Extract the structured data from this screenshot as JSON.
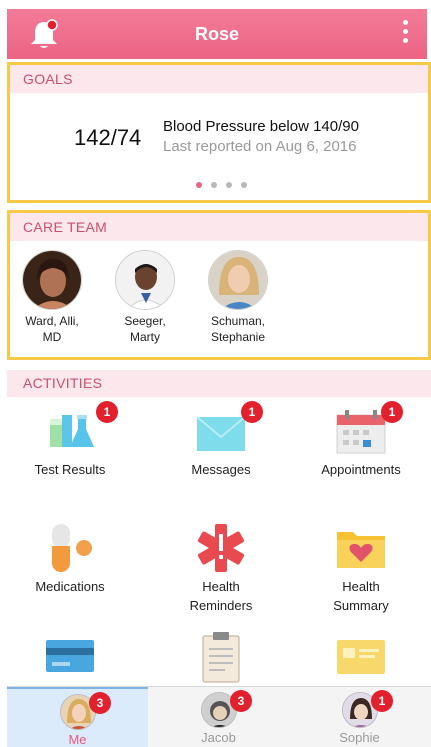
{
  "header": {
    "title": "Rose",
    "bell_icon": "bell-icon",
    "menu_icon": "kebab-menu-icon",
    "brand_color": "#ec6384"
  },
  "goals": {
    "heading": "GOALS",
    "value": "142/74",
    "title": "Blood Pressure below 140/90",
    "subtitle": "Last reported on Aug 6, 2016",
    "pages": 4,
    "active_page": 1
  },
  "care_team": {
    "heading": "CARE TEAM",
    "members": [
      {
        "line1": "Ward, Alli,",
        "line2": "MD"
      },
      {
        "line1": "Seeger,",
        "line2": "Marty"
      },
      {
        "line1": "Schuman,",
        "line2": "Stephanie"
      }
    ]
  },
  "activities": {
    "heading": "ACTIVITIES",
    "items": [
      {
        "line1": "Test Results",
        "line2": "",
        "badge": "1",
        "icon": "test-tubes-icon"
      },
      {
        "line1": "Messages",
        "line2": "",
        "badge": "1",
        "icon": "envelope-icon"
      },
      {
        "line1": "Appointments",
        "line2": "",
        "badge": "1",
        "icon": "calendar-icon"
      },
      {
        "line1": "Medications",
        "line2": "",
        "badge": "",
        "icon": "pill-icon"
      },
      {
        "line1": "Health",
        "line2": "Reminders",
        "badge": "",
        "icon": "medical-alert-icon"
      },
      {
        "line1": "Health",
        "line2": "Summary",
        "badge": "",
        "icon": "heart-folder-icon"
      },
      {
        "line1": "",
        "line2": "",
        "badge": "",
        "icon": "credit-card-icon"
      },
      {
        "line1": "",
        "line2": "",
        "badge": "",
        "icon": "clipboard-icon"
      },
      {
        "line1": "",
        "line2": "",
        "badge": "",
        "icon": "id-card-icon"
      }
    ]
  },
  "tabs": [
    {
      "label": "Me",
      "badge": "3",
      "active": true
    },
    {
      "label": "Jacob",
      "badge": "3",
      "active": false
    },
    {
      "label": "Sophie",
      "badge": "1",
      "active": false
    }
  ],
  "colors": {
    "panel_border": "#f7c948",
    "section_header_bg": "#fbe7ec",
    "badge": "#e3202d"
  }
}
